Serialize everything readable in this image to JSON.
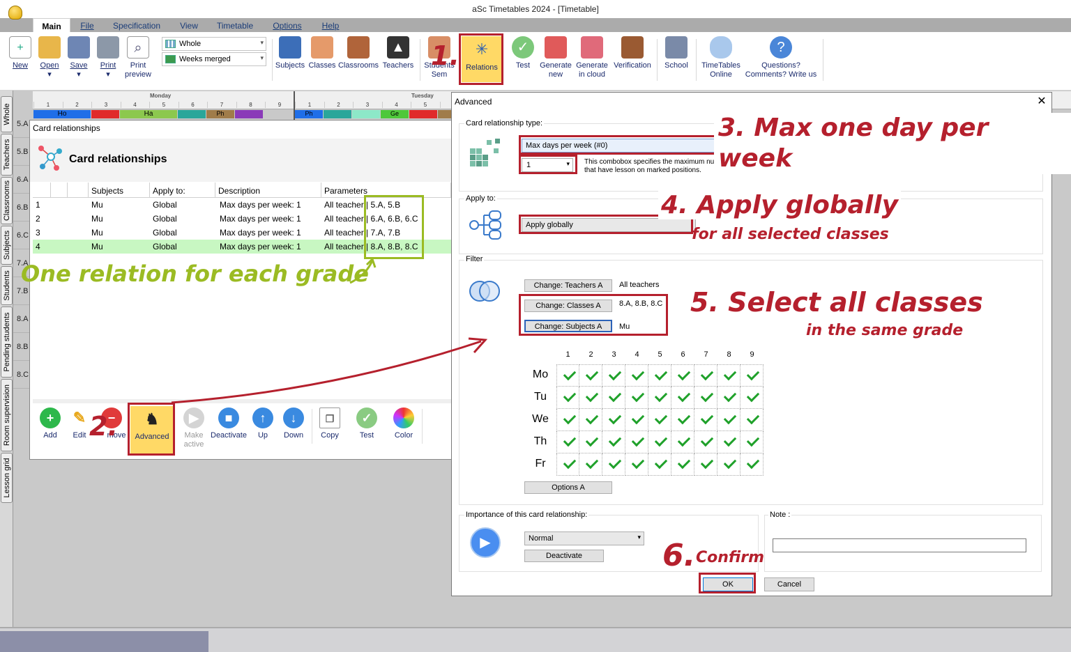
{
  "window": {
    "title": "aSc Timetables 2024  - [Timetable]"
  },
  "menu_tabs": [
    "Main",
    "File",
    "Specification",
    "View",
    "Timetable",
    "Options",
    "Help"
  ],
  "ribbon": {
    "new": "New",
    "open": "Open",
    "save": "Save",
    "print": "Print",
    "print_preview_1": "Print",
    "print_preview_2": "preview",
    "combo_view": "Whole",
    "combo_weeks": "Weeks merged",
    "subjects": "Subjects",
    "classes": "Classes",
    "classrooms": "Classrooms",
    "teachers": "Teachers",
    "students_1": "Students",
    "students_2": "Sem",
    "relations": "Relations",
    "test": "Test",
    "generate_new_1": "Generate",
    "generate_new_2": "new",
    "generate_cloud_1": "Generate",
    "generate_cloud_2": "in cloud",
    "verification": "Verification",
    "school": "School",
    "online_1": "TimeTables",
    "online_2": "Online",
    "questions_1": "Questions?",
    "questions_2": "Comments? Write us"
  },
  "side_tabs": [
    "Whole",
    "Teachers",
    "Classrooms",
    "Subjects",
    "Students",
    "Pending students",
    "Room supervision",
    "Lesson grid"
  ],
  "grid": {
    "day1": "Monday",
    "day2": "Tuesday",
    "periods": [
      "1",
      "2",
      "3",
      "4",
      "5",
      "6",
      "7",
      "8",
      "9"
    ],
    "rows": [
      "5.A",
      "5.B",
      "6.A",
      "6.B",
      "6.C",
      "7.A",
      "7.B",
      "8.A",
      "8.B",
      "8.C"
    ],
    "lessons": [
      "Ho",
      "Ha",
      "Ph",
      "Ph",
      "Ge"
    ]
  },
  "card_relationships": {
    "window_title": "Card relationships",
    "heading": "Card relationships",
    "columns": [
      "Subjects",
      "Apply to:",
      "Description",
      "Parameters"
    ],
    "rows": [
      {
        "n": "1",
        "subject": "Mu",
        "apply": "Global",
        "desc": "Max days per week: 1",
        "params": "All teacher",
        "classes": "| 5.A, 5.B"
      },
      {
        "n": "2",
        "subject": "Mu",
        "apply": "Global",
        "desc": "Max days per week: 1",
        "params": "All teacher",
        "classes": "| 6.A, 6.B, 6.C"
      },
      {
        "n": "3",
        "subject": "Mu",
        "apply": "Global",
        "desc": "Max days per week: 1",
        "params": "All teacher",
        "classes": "| 7.A, 7.B"
      },
      {
        "n": "4",
        "subject": "Mu",
        "apply": "Global",
        "desc": "Max days per week: 1",
        "params": "All teacher",
        "classes": "| 8.A, 8.B, 8.C"
      }
    ],
    "buttons": {
      "add": "Add",
      "edit": "Edit",
      "remove": "move",
      "advanced": "Advanced",
      "make_active_1": "Make",
      "make_active_2": "active",
      "deactivate": "Deactivate",
      "up": "Up",
      "down": "Down",
      "copy": "Copy",
      "test": "Test",
      "color": "Color"
    }
  },
  "advanced": {
    "title": "Advanced",
    "type_label": "Card relationship type:",
    "type_value": "Max days per week (#0)",
    "num_value": "1",
    "hint_1": "This combobox specifies the maximum number of days",
    "hint_2": "that have lesson on marked positions.",
    "apply_label": "Apply to:",
    "apply_value": "Apply globally",
    "filter_label": "Filter",
    "btn_teachers": "Change: Teachers A",
    "val_teachers": "All teachers",
    "btn_classes": "Change: Classes A",
    "val_classes": "8.A, 8.B, 8.C",
    "btn_subjects": "Change: Subjects A",
    "val_subjects": "Mu",
    "period_headers": [
      "1",
      "2",
      "3",
      "4",
      "5",
      "6",
      "7",
      "8",
      "9"
    ],
    "days": [
      "Mo",
      "Tu",
      "We",
      "Th",
      "Fr"
    ],
    "options": "Options A",
    "importance_label": "Importance of this card relationship:",
    "importance_value": "Normal",
    "deactivate": "Deactivate",
    "note_label": "Note :",
    "ok": "OK",
    "cancel": "Cancel"
  },
  "annotations": {
    "step1": "1.",
    "step2": "2.",
    "step3": "3. Max one day per week",
    "step4": "4. Apply globally",
    "step4b": "for all selected classes",
    "step5": "5. Select all classes",
    "step5b": "in the same grade",
    "step6": "6.",
    "step6b": "Confirm",
    "green": "One relation for each grade"
  },
  "colors": {
    "accent_red": "#b5202d",
    "accent_green": "#9bbb23",
    "selected_row": "#c8f7c2",
    "highlight": "#ffd966"
  }
}
